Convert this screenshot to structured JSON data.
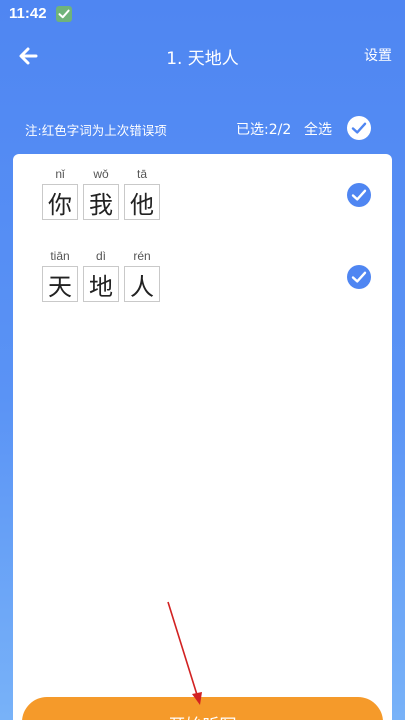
{
  "status_bar": {
    "time": "11:42"
  },
  "header": {
    "title": "1. 天地人",
    "settings_label": "设置"
  },
  "hint_row": {
    "note": "注:红色字词为上次错误项",
    "selected_text": "已选:2/2",
    "select_all_label": "全选",
    "select_all_checked": true
  },
  "words": [
    {
      "checked": true,
      "chars": [
        {
          "pinyin": "nǐ",
          "hanzi": "你"
        },
        {
          "pinyin": "wǒ",
          "hanzi": "我"
        },
        {
          "pinyin": "tā",
          "hanzi": "他"
        }
      ]
    },
    {
      "checked": true,
      "chars": [
        {
          "pinyin": "tiān",
          "hanzi": "天"
        },
        {
          "pinyin": "dì",
          "hanzi": "地"
        },
        {
          "pinyin": "rén",
          "hanzi": "人"
        }
      ]
    }
  ],
  "footer": {
    "start_label": "开始听写"
  },
  "colors": {
    "primary_blue": "#4F86F2",
    "start_orange": "#F59A2A"
  },
  "icons": {
    "back": "arrow-left-icon",
    "check": "check-circle-icon",
    "status_check": "check-square-icon",
    "annotation": "red-arrow-annotation"
  }
}
